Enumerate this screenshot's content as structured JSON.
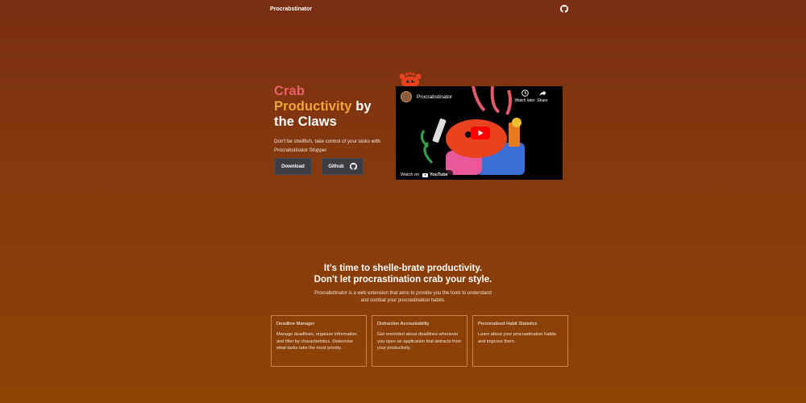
{
  "nav": {
    "brand": "Procrabstinator"
  },
  "hero": {
    "headline_part1": "Crab",
    "headline_part2": "Productivity",
    "headline_part3": "by",
    "headline_part4": "the Claws",
    "tagline": "Don't be shellfish, take control of your tasks with Procrabstinator Stopper",
    "download_label": "Download",
    "github_label": "Github"
  },
  "video": {
    "channel_title": "Procrabstinator",
    "watch_later_label": "Watch later",
    "share_label": "Share",
    "watch_on_label": "Watch on",
    "youtube_label": "YouTube"
  },
  "features": {
    "title_line1": "It's time to shelle-brate productivity.",
    "title_line2": "Don't let procrastination crab your style.",
    "description": "Procrabstinator is a web extension that aims to provide you the tools to understand and combat your procrastination habits.",
    "cards": [
      {
        "title": "Deadline Manager",
        "body": "Manage deadlines, organize information, and filter by characteristics. Determine what tasks take the most priority."
      },
      {
        "title": "Distraction Accountability",
        "body": "Get reminded about deadlines whenever you open an application that detracts from your productivity."
      },
      {
        "title": "Personalized Habit Statistics",
        "body": "Learn about your procrastination habits and improve them."
      }
    ]
  },
  "colors": {
    "accent_pink": "#ee5f6b",
    "accent_orange": "#f4a53a",
    "background_top": "#7a2e12",
    "background_bottom": "#8e4304",
    "button_bg": "#3c3e44",
    "card_border": "#c8874e",
    "youtube_red": "#ff0000"
  },
  "icons": {
    "nav_github": "github-icon",
    "button_github": "github-icon",
    "watch_later": "clock-icon",
    "share": "share-arrow-icon",
    "play": "play-icon"
  }
}
